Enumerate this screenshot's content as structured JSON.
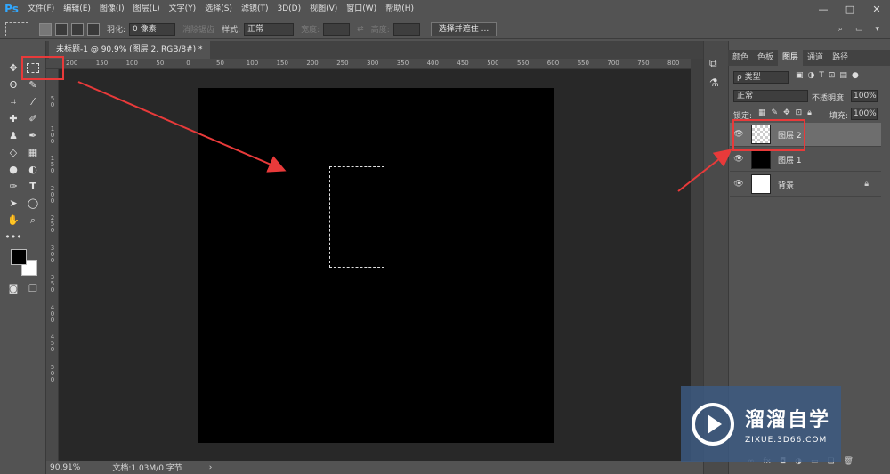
{
  "app_logo": "Ps",
  "menus": [
    "文件(F)",
    "编辑(E)",
    "图像(I)",
    "图层(L)",
    "文字(Y)",
    "选择(S)",
    "滤镜(T)",
    "3D(D)",
    "视图(V)",
    "窗口(W)",
    "帮助(H)"
  ],
  "window_controls": [
    "—",
    "□",
    "✕"
  ],
  "options": {
    "feather_label": "羽化:",
    "feather_value": "0 像素",
    "antialias_label": "消除锯齿",
    "style_label": "样式:",
    "style_value": "正常",
    "width_label": "宽度:",
    "height_label": "高度:",
    "select_mask_button": "选择并遮住 ..."
  },
  "document": {
    "tab_title": "未标题-1 @ 90.9% (图层 2, RGB/8#) *",
    "zoom": "90.91%",
    "doc_info": "文档:1.03M/0 字节",
    "ruler_top": [
      "200",
      "150",
      "100",
      "50",
      "0",
      "50",
      "100",
      "150",
      "200",
      "250",
      "300",
      "350",
      "400",
      "450",
      "500",
      "550",
      "600",
      "650",
      "700",
      "750",
      "800"
    ],
    "ruler_left": [
      "5\n0",
      "1\n0\n0",
      "1\n5\n0",
      "2\n0\n0",
      "2\n5\n0",
      "3\n0\n0",
      "3\n5\n0",
      "4\n0\n0",
      "4\n5\n0",
      "5\n0\n0"
    ]
  },
  "panel": {
    "tabs": [
      "颜色",
      "色板",
      "图层",
      "通道",
      "路径"
    ],
    "active_tab": "图层",
    "filter_label": "ρ 类型",
    "blend_mode": "正常",
    "opacity_label": "不透明度:",
    "opacity_value": "100%",
    "lock_label": "锁定:",
    "fill_label": "填充:",
    "fill_value": "100%",
    "layers": [
      {
        "name": "图层 2",
        "thumb": "transparent",
        "selected": true
      },
      {
        "name": "图层 1",
        "thumb": "#000000",
        "selected": false
      },
      {
        "name": "背景",
        "thumb": "#ffffff",
        "selected": false,
        "locked": true
      }
    ]
  },
  "watermark": {
    "title": "溜溜自学",
    "url": "ZIXUE.3D66.COM"
  },
  "colors": {
    "ui_bg": "#535353",
    "workspace": "#282828",
    "annotation_red": "#e83a3a",
    "ps_blue": "#31a8ff"
  }
}
